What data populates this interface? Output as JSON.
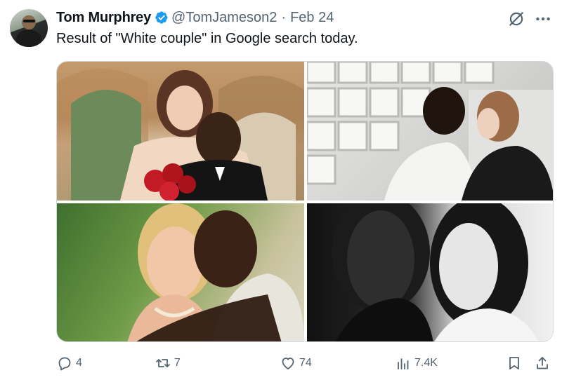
{
  "author": {
    "name": "Tom Murphrey",
    "handle": "@TomJameson2",
    "separator": "·",
    "date": "Feb 24"
  },
  "tweet": {
    "text": "Result of \"White couple\" in Google search today."
  },
  "media": {
    "photos": [
      {
        "description": "bride and groom embracing, groom holding red roses"
      },
      {
        "description": "couple kissing in front of glass block wall"
      },
      {
        "description": "smiling couple outdoors in greenery"
      },
      {
        "description": "black and white portrait of a couple"
      }
    ]
  },
  "actions": {
    "replies": "4",
    "reposts": "7",
    "likes": "74",
    "views": "7.4K"
  },
  "colors": {
    "text": "#0f1419",
    "secondary": "#536471",
    "verified": "#1d9bf0",
    "border": "#cfd9de"
  },
  "icons": [
    "verified-badge-icon",
    "grok-icon",
    "more-icon",
    "reply-icon",
    "retweet-icon",
    "like-icon",
    "views-icon",
    "bookmark-icon",
    "share-icon"
  ]
}
